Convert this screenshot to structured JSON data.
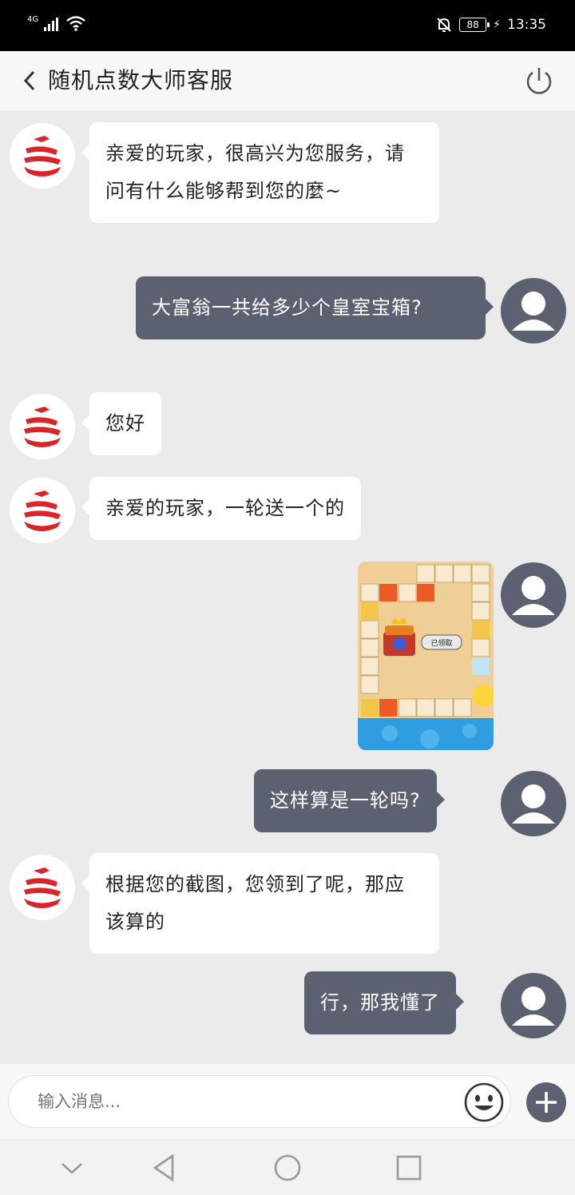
{
  "status_bar": {
    "network": "4G",
    "battery": "88",
    "time": "13:35"
  },
  "header": {
    "title": "随机点数大师客服"
  },
  "messages": [
    {
      "side": "left",
      "text": "亲爱的玩家，很高兴为您服务，请问有什么能够帮到您的麼~"
    },
    {
      "side": "right",
      "text": "大富翁一共给多少个皇室宝箱?"
    },
    {
      "side": "left",
      "text": "您好"
    },
    {
      "side": "left",
      "text": "亲爱的玩家，一轮送一个的"
    },
    {
      "side": "right",
      "type": "image",
      "image_label": "已领取"
    },
    {
      "side": "right",
      "text": "这样算是一轮吗?"
    },
    {
      "side": "left",
      "text": "根据您的截图，您领到了呢，那应该算的"
    },
    {
      "side": "right",
      "text": "行，那我懂了"
    }
  ],
  "input": {
    "placeholder": "输入消息..."
  },
  "colors": {
    "user_bubble": "#5b6170",
    "bot_bubble": "#ffffff",
    "background": "#ebebeb",
    "bot_logo": "#d9242a"
  }
}
